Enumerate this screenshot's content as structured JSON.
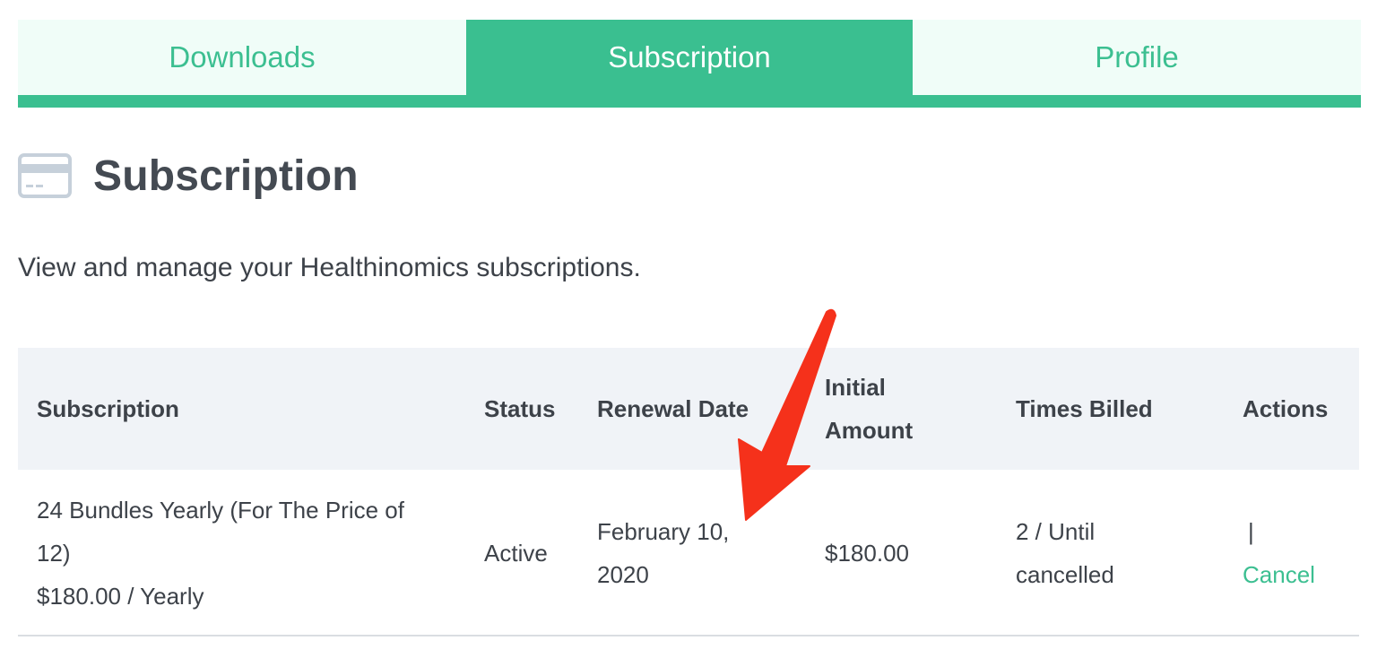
{
  "tabs": [
    {
      "label": "Downloads",
      "active": false
    },
    {
      "label": "Subscription",
      "active": true
    },
    {
      "label": "Profile",
      "active": false
    }
  ],
  "header": {
    "icon": "credit-card-icon",
    "title": "Subscription",
    "description": "View and manage your Healthinomics subscriptions."
  },
  "table": {
    "columns": [
      "Subscription",
      "Status",
      "Renewal Date",
      "Initial",
      "Amount",
      "Times Billed",
      "Actions"
    ],
    "row": {
      "subscription_line1": "24 Bundles Yearly (For The Price of",
      "subscription_line2": "12)",
      "subscription_price": "$180.00 / Yearly",
      "status": "Active",
      "renewal_line1": "February 10,",
      "renewal_line2": "2020",
      "initial_amount": "$180.00",
      "times_billed_line1": "2 / Until",
      "times_billed_line2": "cancelled",
      "actions_separator": "|",
      "actions_cancel": "Cancel"
    }
  },
  "annotation": {
    "type": "arrow",
    "color": "#f5311b",
    "target": "renewal-date"
  },
  "colors": {
    "accent": "#3abf90",
    "tab_bg": "#f0fdf8",
    "header_bg": "#f0f3f7",
    "text": "#3d4249"
  }
}
